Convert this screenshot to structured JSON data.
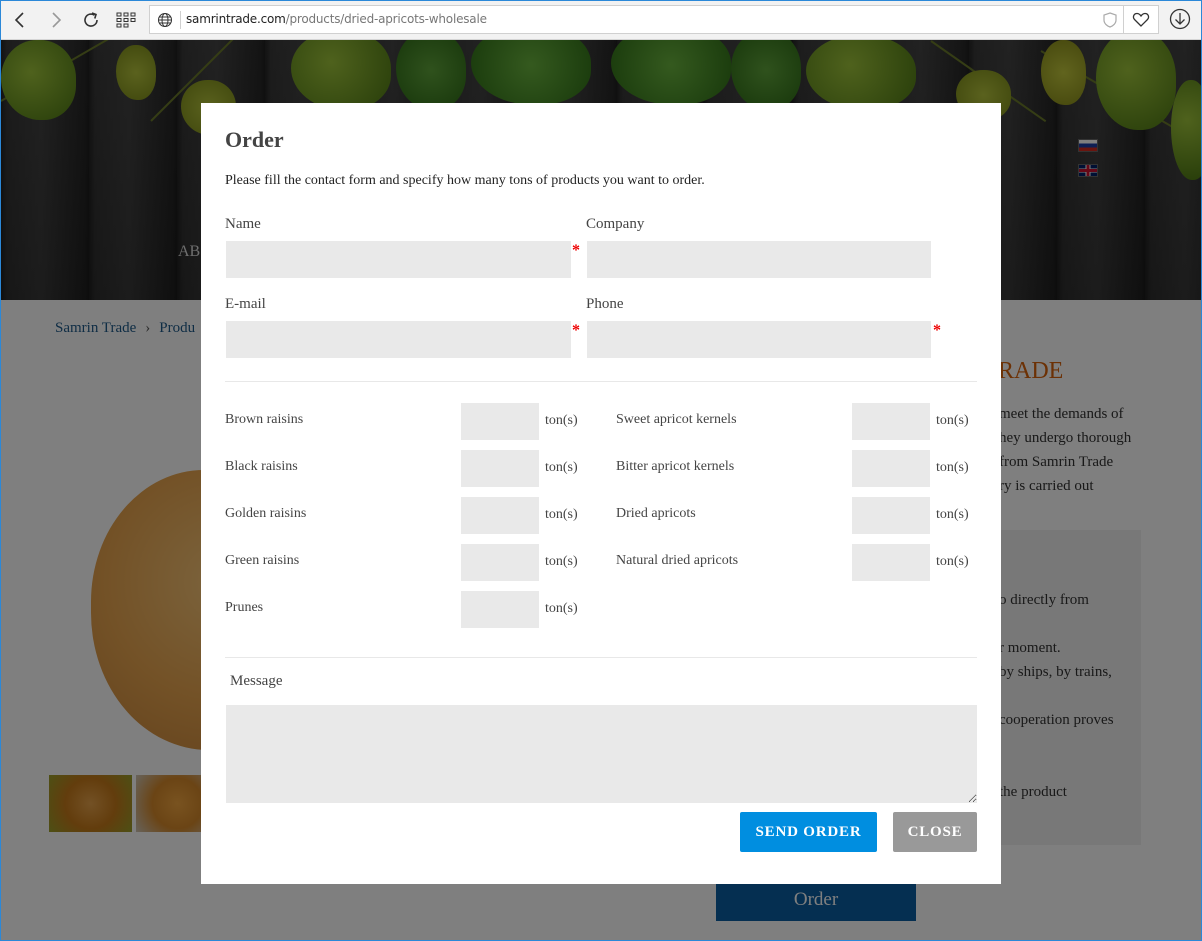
{
  "browser": {
    "url_host": "samrintrade.com",
    "url_path": "/products/dried-apricots-wholesale",
    "icons": [
      "back-icon",
      "forward-icon",
      "refresh-icon",
      "apps-grid-icon",
      "globe-icon",
      "shield-icon",
      "favorite-heart-icon",
      "download-icon"
    ]
  },
  "background_page": {
    "nav_partial": "AB",
    "breadcrumb": [
      "Samrin Trade",
      "Produ"
    ],
    "breadcrumb_separator": "›",
    "languages": [
      "Russian",
      "English"
    ],
    "heading_partial": "RADE",
    "text_lines": [
      "meet the demands of",
      "hey undergo thorough",
      "from Samrin Trade",
      "ry is carried out"
    ],
    "info_lines": [
      "o directly from",
      "r moment.",
      "by ships, by trains,",
      "cooperation proves",
      "the product"
    ],
    "order_button": "Order",
    "accent_color": "#d9620a"
  },
  "modal": {
    "title": "Order",
    "intro": "Please fill the contact form and specify how many tons of products you want to order.",
    "required_mark": "*",
    "fields": {
      "name": {
        "label": "Name",
        "value": "",
        "required": true
      },
      "company": {
        "label": "Company",
        "value": "",
        "required": false
      },
      "email": {
        "label": "E-mail",
        "value": "",
        "required": true
      },
      "phone": {
        "label": "Phone",
        "value": "",
        "required": true
      }
    },
    "unit": "ton(s)",
    "products_left": [
      {
        "label": "Brown raisins",
        "value": ""
      },
      {
        "label": "Black raisins",
        "value": ""
      },
      {
        "label": "Golden raisins",
        "value": ""
      },
      {
        "label": "Green raisins",
        "value": ""
      },
      {
        "label": "Prunes",
        "value": ""
      }
    ],
    "products_right": [
      {
        "label": "Sweet apricot kernels",
        "value": ""
      },
      {
        "label": "Bitter apricot kernels",
        "value": ""
      },
      {
        "label": "Dried apricots",
        "value": ""
      },
      {
        "label": "Natural dried apricots",
        "value": ""
      }
    ],
    "message": {
      "label": "Message",
      "value": ""
    },
    "send_label": "SEND ORDER",
    "close_label": "CLOSE",
    "send_color": "#008ee0",
    "close_color": "#999999"
  }
}
